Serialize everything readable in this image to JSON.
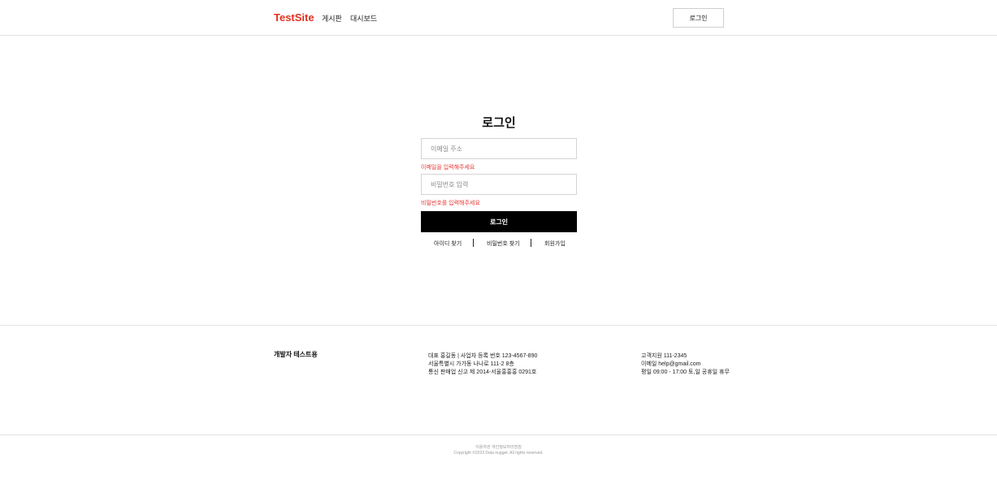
{
  "header": {
    "logo": "TestSite",
    "nav": [
      "게시판",
      "대시보드"
    ],
    "login_button": "로그인"
  },
  "login_form": {
    "title": "로그인",
    "email_placeholder": "이메일 주소",
    "email_error": "이메일을 입력해주세요",
    "password_placeholder": "비밀번호 입력",
    "password_error": "비밀번호를 입력해주세요",
    "submit_label": "로그인",
    "links": [
      "아이디 찾기",
      "비밀번호 찾기",
      "회원가입"
    ]
  },
  "footer": {
    "brand": "개발자 테스트용",
    "company_info": [
      "대표 홍길동  |  사업자 등록 번호 123-4567-890",
      "서울특별시 가가동 나나로 111-2 8층",
      "통신 판매업 신고 제 2014-서울홍홍홍 0291호"
    ],
    "support_info": [
      "고객지원 111-2345",
      "이메일 help@gmail.com",
      "평일 09:00 - 17:00 토,일 공휴일 휴무"
    ],
    "legal_links": "이용약관 개인정보처리방침",
    "copyright": "Copyright ©2023 Data nugget. All rights reserved."
  }
}
